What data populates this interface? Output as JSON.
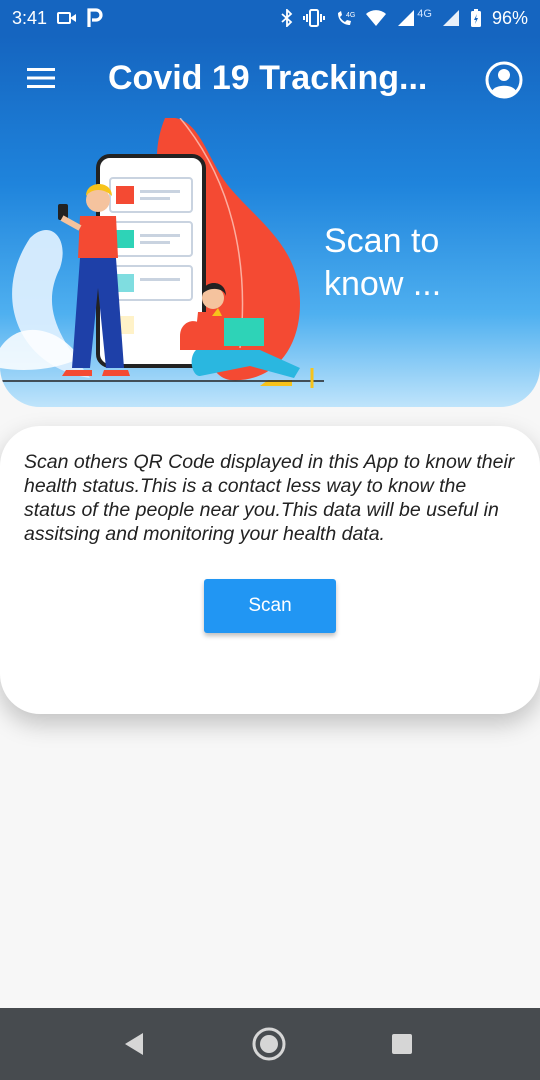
{
  "status_bar": {
    "time": "3:41",
    "net_label_1": "4G",
    "net_label_2": "4G",
    "battery_percent": "96%",
    "icons": [
      "video-icon",
      "parking-icon",
      "bluetooth-icon",
      "vibrate-icon",
      "volte-call-icon",
      "wifi-icon",
      "signal-icon",
      "signal-icon",
      "battery-charging-icon"
    ]
  },
  "app_bar": {
    "title": "Covid 19 Tracking...",
    "menu_icon": "hamburger-menu-icon",
    "account_icon": "account-circle-icon"
  },
  "hero": {
    "text": "Scan to know ..."
  },
  "card": {
    "description": "Scan others QR Code displayed in this App to know their health status.This is a contact less way to know the status of the people near you.This data will be useful in assitsing and monitoring your health data.",
    "scan_label": "Scan"
  },
  "nav_bar": {
    "icons": [
      "back-icon",
      "home-icon",
      "recents-icon"
    ]
  },
  "colors": {
    "primary": "#1565c0",
    "button": "#2196f3",
    "illustration_accent": "#f44a33"
  }
}
